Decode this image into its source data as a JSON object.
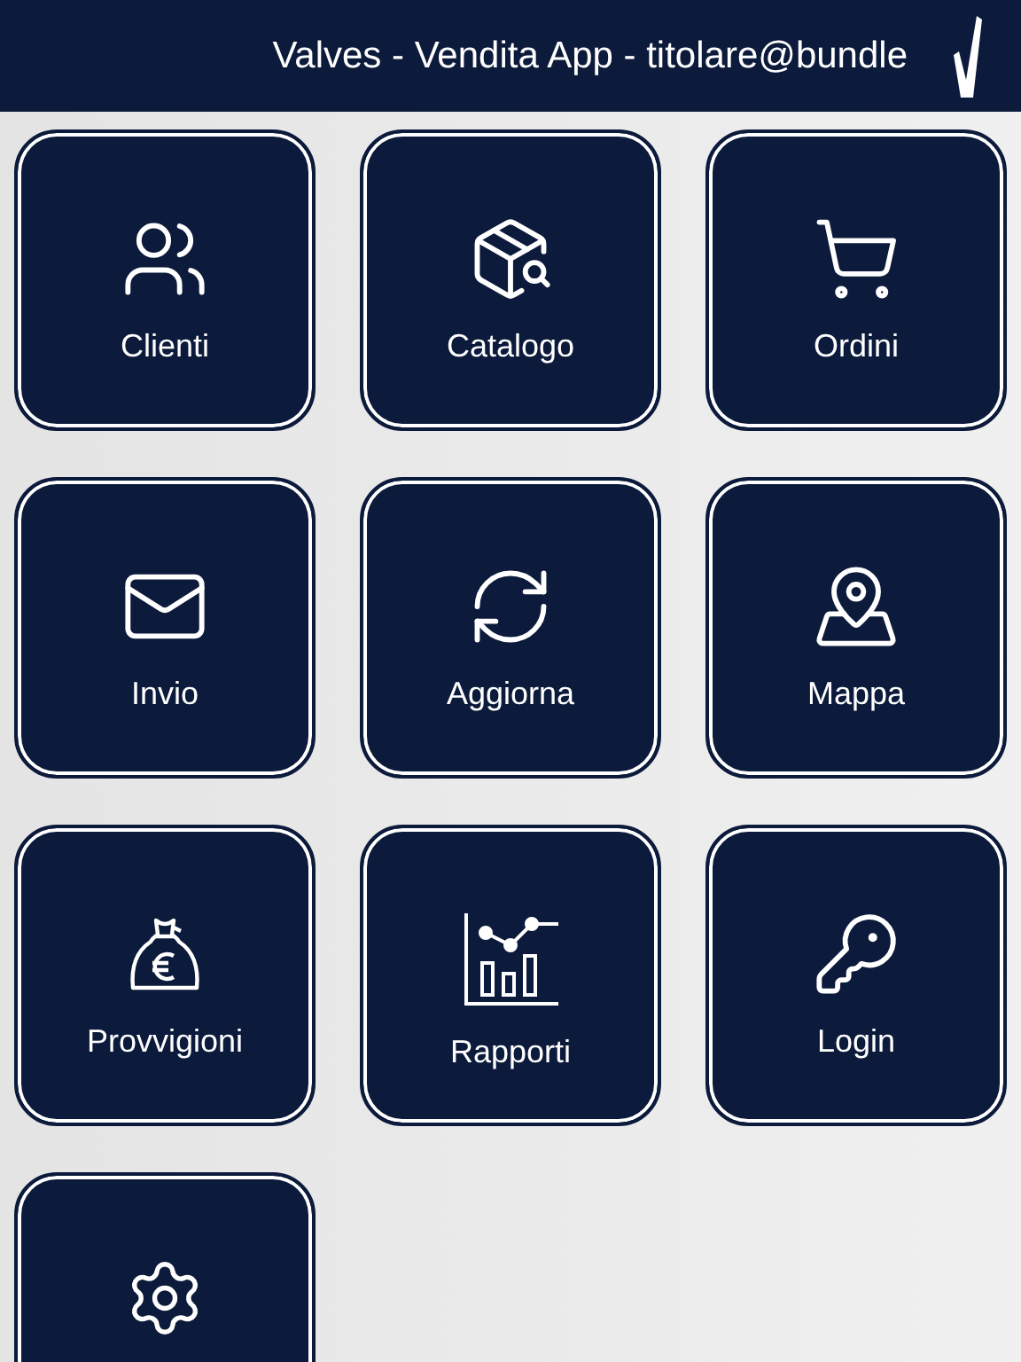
{
  "header": {
    "title": "Valves - Vendita App - titolare@bundle"
  },
  "tiles": [
    {
      "kind": "labelled",
      "label": "Clienti"
    },
    {
      "kind": "labelled",
      "label": "Catalogo"
    },
    {
      "kind": "labelled",
      "label": "Ordini"
    },
    {
      "kind": "labelled",
      "label": "Invio"
    },
    {
      "kind": "labelled",
      "label": "Aggiorna"
    },
    {
      "kind": "labelled",
      "label": "Mappa"
    },
    {
      "kind": "labelled",
      "label": "Provvigioni"
    },
    {
      "kind": "labelled",
      "label": "Rapporti"
    },
    {
      "kind": "labelled",
      "label": "Login"
    },
    {
      "kind": "unlabelled"
    }
  ]
}
